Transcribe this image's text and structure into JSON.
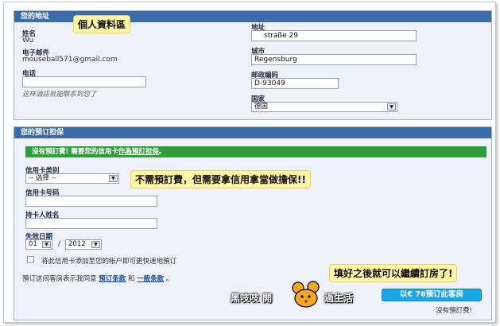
{
  "annotations": {
    "profile": "個人資料區",
    "deposit": "不需預訂費，但需要拿信用拿當做擔保!!",
    "after": "填好之後就可以繼續訂房了!"
  },
  "address_section": {
    "title": "您的地址",
    "name_label": "姓名",
    "name_value": "Wu",
    "email_label": "电子邮件",
    "email_value": "mouseball571@gmail.com",
    "phone_label": "电话",
    "phone_value": "",
    "phone_hint": "这样酒店就能联系到您了",
    "address_label": "地址",
    "address_value": "straße 29",
    "city_label": "城市",
    "city_value": "Regensburg",
    "zip_label": "邮政编码",
    "zip_value": "D-93049",
    "country_label": "国家",
    "country_value": "德国"
  },
  "guarantee_section": {
    "title": "您的預订担保",
    "notice_prefix": "沒有預訂費! 需要您的信用卡",
    "notice_link": "作為預訂担保",
    "notice_suffix": "。",
    "card_type_label": "信用卡类别",
    "card_type_value": "-- 选择 --",
    "card_number_label": "信用卡号码",
    "card_holder_label": "持卡人姓名",
    "expiry_label": "失效日期",
    "expiry_month": "01",
    "expiry_sep": "/",
    "expiry_year": "2012",
    "save_card_label": "将此信用卡添加至您的帐户即可更快速地預订",
    "terms_prefix": "預订这间客房表示我同意",
    "terms_link1": "預订条款",
    "terms_and": "和",
    "terms_link2": "一般条款",
    "terms_suffix": "。",
    "book_button": "以€ 76預订此客房",
    "no_fee": "沒有預訂费!"
  },
  "watermark": {
    "left": "黑吱吱 開",
    "right": "過生活"
  },
  "colors": {
    "header": "#3d6aa8",
    "notice": "#2f9e3a",
    "button": "#1aa7e8",
    "annotation": "#fff7a6"
  }
}
